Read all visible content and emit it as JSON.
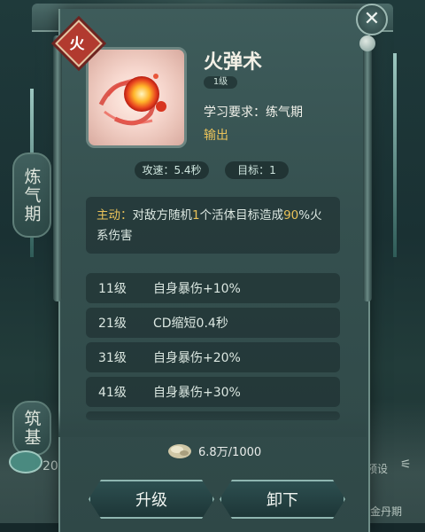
{
  "skill": {
    "element": "火",
    "name": "火弹术",
    "level": "1级",
    "requirement_label": "学习要求：",
    "requirement_value": "练气期",
    "output_label": "输出",
    "attack_speed": "攻速：5.4秒",
    "targets": "目标：1",
    "description": {
      "prefix": "主动：",
      "text_a": "对敌方随机",
      "num_a": "1",
      "text_b": "个活体目标造成",
      "num_b": "90",
      "text_c": "%火系伤害"
    }
  },
  "upgrades": [
    {
      "level": "11级",
      "effect": "自身暴伤+10%"
    },
    {
      "level": "21级",
      "effect": "CD缩短0.4秒"
    },
    {
      "level": "31级",
      "effect": "自身暴伤+20%"
    },
    {
      "level": "41级",
      "effect": "自身暴伤+30%"
    }
  ],
  "cost": "6.8万/1000",
  "buttons": {
    "upgrade": "升级",
    "unequip": "卸下"
  },
  "side": {
    "lantern_left_1": "炼气期",
    "lantern_left_2": "筑基",
    "left_number": "20",
    "preset": "预设",
    "bottom_right": "金丹期"
  },
  "colors": {
    "accent_gold": "#e9c25a",
    "fire_badge": "#b23a2f"
  }
}
